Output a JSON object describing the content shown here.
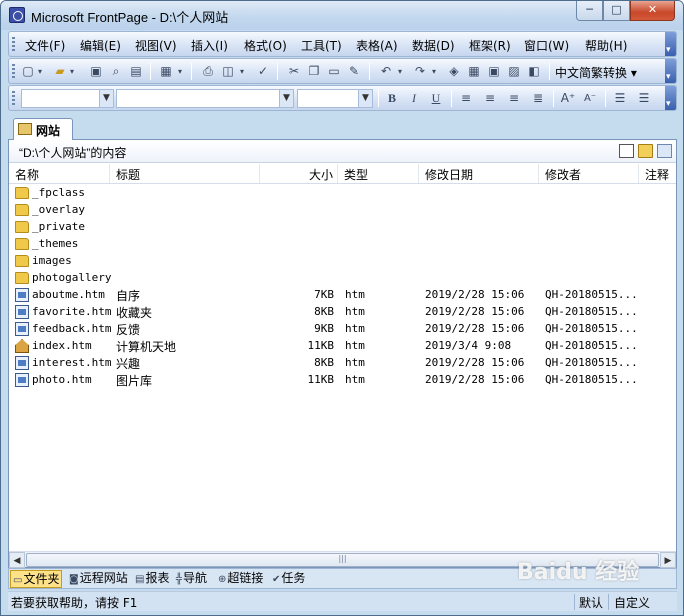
{
  "window": {
    "title": "Microsoft FrontPage - D:\\个人网站",
    "min_label": "─",
    "max_label": "□",
    "close_label": "✕"
  },
  "menubar": {
    "items": [
      "文件(F)",
      "编辑(E)",
      "视图(V)",
      "插入(I)",
      "格式(O)",
      "工具(T)",
      "表格(A)",
      "数据(D)",
      "框架(R)",
      "窗口(W)",
      "帮助(H)"
    ]
  },
  "toolbar": {
    "ime_label": "中文简繁转换 ▾"
  },
  "format_toolbar": {
    "style_value": "",
    "font_value": "",
    "size_value": "",
    "bold": "B",
    "italic": "I",
    "underline": "U"
  },
  "tabs": {
    "web": "网站"
  },
  "content": {
    "path_label": "“D:\\个人网站”的内容",
    "columns": [
      "名称",
      "标题",
      "大小",
      "类型",
      "修改日期",
      "修改者",
      "注释"
    ],
    "folders": [
      "_fpclass",
      "_overlay",
      "_private",
      "_themes",
      "images",
      "photogallery"
    ],
    "files": [
      {
        "name": "aboutme.htm",
        "title": "自序",
        "size": "7KB",
        "type": "htm",
        "modified": "2019/2/28 15:06",
        "author": "QH-20180515...",
        "icon": "page-icon"
      },
      {
        "name": "favorite.htm",
        "title": "收藏夹",
        "size": "8KB",
        "type": "htm",
        "modified": "2019/2/28 15:06",
        "author": "QH-20180515...",
        "icon": "page-icon"
      },
      {
        "name": "feedback.htm",
        "title": "反馈",
        "size": "9KB",
        "type": "htm",
        "modified": "2019/2/28 15:06",
        "author": "QH-20180515...",
        "icon": "page-icon"
      },
      {
        "name": "index.htm",
        "title": "计算机天地",
        "size": "11KB",
        "type": "htm",
        "modified": "2019/3/4 9:08",
        "author": "QH-20180515...",
        "icon": "home-page-icon"
      },
      {
        "name": "interest.htm",
        "title": "兴趣",
        "size": "8KB",
        "type": "htm",
        "modified": "2019/2/28 15:06",
        "author": "QH-20180515...",
        "icon": "page-icon"
      },
      {
        "name": "photo.htm",
        "title": "图片库",
        "size": "11KB",
        "type": "htm",
        "modified": "2019/2/28 15:06",
        "author": "QH-20180515...",
        "icon": "page-icon"
      }
    ]
  },
  "viewbar": {
    "items": [
      "文件夹",
      "远程网站",
      "报表",
      "导航",
      "超链接",
      "任务"
    ],
    "active": "文件夹"
  },
  "statusbar": {
    "help": "若要获取帮助，请按 F1",
    "mode": "默认",
    "custom": "自定义"
  },
  "watermark": "Baidu 经验",
  "colors": {
    "title_gradient": "#c3d8ee",
    "active_view": "#fde28a",
    "frame": "#c5dcef"
  }
}
